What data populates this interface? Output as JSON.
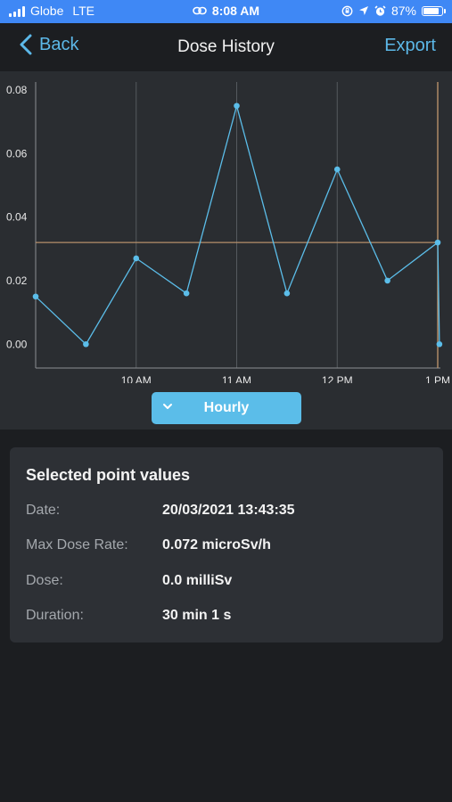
{
  "status_bar": {
    "carrier": "Globe",
    "network": "LTE",
    "time": "8:08 AM",
    "battery": "87%",
    "battery_level": 0.87
  },
  "nav": {
    "back_label": "Back",
    "title": "Dose History",
    "export_label": "Export"
  },
  "chart_data": {
    "type": "line",
    "x_tick_labels": [
      "10 AM",
      "11 AM",
      "12 PM",
      "1 PM"
    ],
    "y_tick_labels": [
      "0.00",
      "0.02",
      "0.04",
      "0.06",
      "0.08"
    ],
    "ylim": [
      -0.0075,
      0.0825
    ],
    "xlim": [
      "09:00",
      "13:00"
    ],
    "grid": "vertical",
    "series": [
      {
        "color": "#5bbde9",
        "points": [
          {
            "t": "09:00",
            "v": 0.015
          },
          {
            "t": "09:30",
            "v": 0.0
          },
          {
            "t": "10:00",
            "v": 0.027
          },
          {
            "t": "10:30",
            "v": 0.016
          },
          {
            "t": "11:00",
            "v": 0.075
          },
          {
            "t": "11:30",
            "v": 0.016
          },
          {
            "t": "12:00",
            "v": 0.055
          },
          {
            "t": "12:30",
            "v": 0.02
          },
          {
            "t": "13:00",
            "v": 0.032
          },
          {
            "t": "13:01",
            "v": 0.0
          }
        ]
      }
    ],
    "average_line": {
      "v": 0.032,
      "color": "#b7906a"
    },
    "selected_marker": {
      "t": "13:00",
      "color": "#b7906a"
    }
  },
  "period_selector": {
    "label": "Hourly"
  },
  "selected_point": {
    "title": "Selected point values",
    "rows": [
      {
        "label": "Date:",
        "value": "20/03/2021 13:43:35"
      },
      {
        "label": "Max Dose Rate:",
        "value": "0.072 microSv/h"
      },
      {
        "label": "Dose:",
        "value": "0.0 milliSv"
      },
      {
        "label": "Duration:",
        "value": "30 min 1 s"
      }
    ]
  },
  "colors": {
    "accent": "#5bbde9",
    "link": "#5cb8e8",
    "status_bar": "#3f88f5",
    "background": "#1c1e21",
    "chart_bg": "#2a2d31",
    "card_bg": "#2d3035"
  }
}
